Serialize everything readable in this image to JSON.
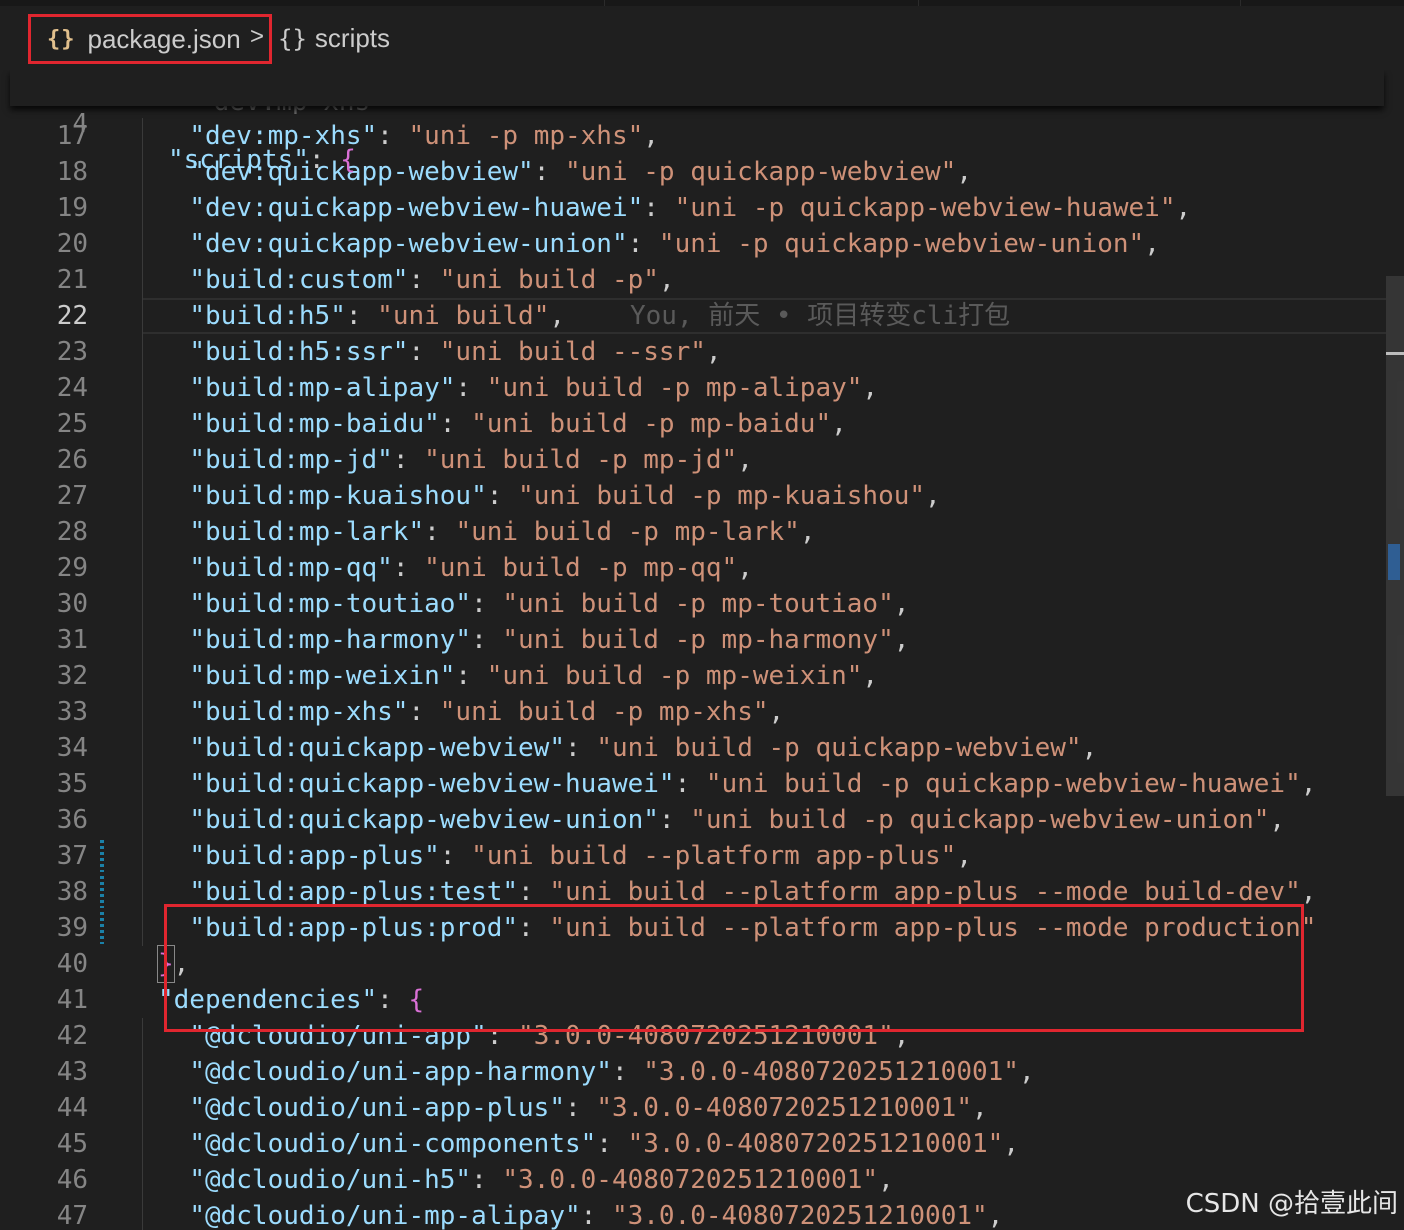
{
  "breadcrumb": {
    "file_icon": "{}",
    "file_label": "package.json",
    "separator": ">",
    "symbol_icon": "{}",
    "symbol_label": "scripts"
  },
  "sticky_scroll": {
    "line_number": "4",
    "key": "\"scripts\"",
    "colon": ": ",
    "brace": "{"
  },
  "current_line": "22",
  "blame_text": "You, 前天 • 项目转变cli打包",
  "lines": [
    {
      "n": "17",
      "k": "\"dev:mp-xhs\"",
      "v": "\"uni -p mp-xhs\"",
      "end": ","
    },
    {
      "n": "18",
      "k": "\"dev:quickapp-webview\"",
      "v": "\"uni -p quickapp-webview\"",
      "end": ","
    },
    {
      "n": "19",
      "k": "\"dev:quickapp-webview-huawei\"",
      "v": "\"uni -p quickapp-webview-huawei\"",
      "end": ","
    },
    {
      "n": "20",
      "k": "\"dev:quickapp-webview-union\"",
      "v": "\"uni -p quickapp-webview-union\"",
      "end": ","
    },
    {
      "n": "21",
      "k": "\"build:custom\"",
      "v": "\"uni build -p\"",
      "end": ","
    },
    {
      "n": "22",
      "k": "\"build:h5\"",
      "v": "\"uni build\"",
      "end": ","
    },
    {
      "n": "23",
      "k": "\"build:h5:ssr\"",
      "v": "\"uni build --ssr\"",
      "end": ","
    },
    {
      "n": "24",
      "k": "\"build:mp-alipay\"",
      "v": "\"uni build -p mp-alipay\"",
      "end": ","
    },
    {
      "n": "25",
      "k": "\"build:mp-baidu\"",
      "v": "\"uni build -p mp-baidu\"",
      "end": ","
    },
    {
      "n": "26",
      "k": "\"build:mp-jd\"",
      "v": "\"uni build -p mp-jd\"",
      "end": ","
    },
    {
      "n": "27",
      "k": "\"build:mp-kuaishou\"",
      "v": "\"uni build -p mp-kuaishou\"",
      "end": ","
    },
    {
      "n": "28",
      "k": "\"build:mp-lark\"",
      "v": "\"uni build -p mp-lark\"",
      "end": ","
    },
    {
      "n": "29",
      "k": "\"build:mp-qq\"",
      "v": "\"uni build -p mp-qq\"",
      "end": ","
    },
    {
      "n": "30",
      "k": "\"build:mp-toutiao\"",
      "v": "\"uni build -p mp-toutiao\"",
      "end": ","
    },
    {
      "n": "31",
      "k": "\"build:mp-harmony\"",
      "v": "\"uni build -p mp-harmony\"",
      "end": ","
    },
    {
      "n": "32",
      "k": "\"build:mp-weixin\"",
      "v": "\"uni build -p mp-weixin\"",
      "end": ","
    },
    {
      "n": "33",
      "k": "\"build:mp-xhs\"",
      "v": "\"uni build -p mp-xhs\"",
      "end": ","
    },
    {
      "n": "34",
      "k": "\"build:quickapp-webview\"",
      "v": "\"uni build -p quickapp-webview\"",
      "end": ","
    },
    {
      "n": "35",
      "k": "\"build:quickapp-webview-huawei\"",
      "v": "\"uni build -p quickapp-webview-huawei\"",
      "end": ","
    },
    {
      "n": "36",
      "k": "\"build:quickapp-webview-union\"",
      "v": "\"uni build -p quickapp-webview-union\"",
      "end": ","
    },
    {
      "n": "37",
      "k": "\"build:app-plus\"",
      "v": "\"uni build --platform app-plus\"",
      "end": ","
    },
    {
      "n": "38",
      "k": "\"build:app-plus:test\"",
      "v": "\"uni build --platform app-plus --mode build-dev\"",
      "end": ","
    },
    {
      "n": "39",
      "k": "\"build:app-plus:prod\"",
      "v": "\"uni build --platform app-plus --mode production\"",
      "end": ""
    }
  ],
  "closing_line": {
    "n": "40",
    "brace": "}",
    "end": ","
  },
  "deps_line": {
    "n": "41",
    "k": "\"dependencies\"",
    "brace": "{"
  },
  "dep_lines": [
    {
      "n": "42",
      "k": "\"@dcloudio/uni-app\"",
      "v": "\"3.0.0-4080720251210001\"",
      "end": ","
    },
    {
      "n": "43",
      "k": "\"@dcloudio/uni-app-harmony\"",
      "v": "\"3.0.0-4080720251210001\"",
      "end": ","
    },
    {
      "n": "44",
      "k": "\"@dcloudio/uni-app-plus\"",
      "v": "\"3.0.0-4080720251210001\"",
      "end": ","
    },
    {
      "n": "45",
      "k": "\"@dcloudio/uni-components\"",
      "v": "\"3.0.0-4080720251210001\"",
      "end": ","
    },
    {
      "n": "46",
      "k": "\"@dcloudio/uni-h5\"",
      "v": "\"3.0.0-4080720251210001\"",
      "end": ","
    },
    {
      "n": "47",
      "k": "\"@dcloudio/uni-mp-alipay\"",
      "v": "\"3.0.0-4080720251210001\"",
      "end": ","
    }
  ],
  "watermark": "CSDN @拾壹此间",
  "colors": {
    "key": "#9cdcfe",
    "string": "#ce9178",
    "brace": "#da70d6",
    "highlight": "#e0262f"
  }
}
